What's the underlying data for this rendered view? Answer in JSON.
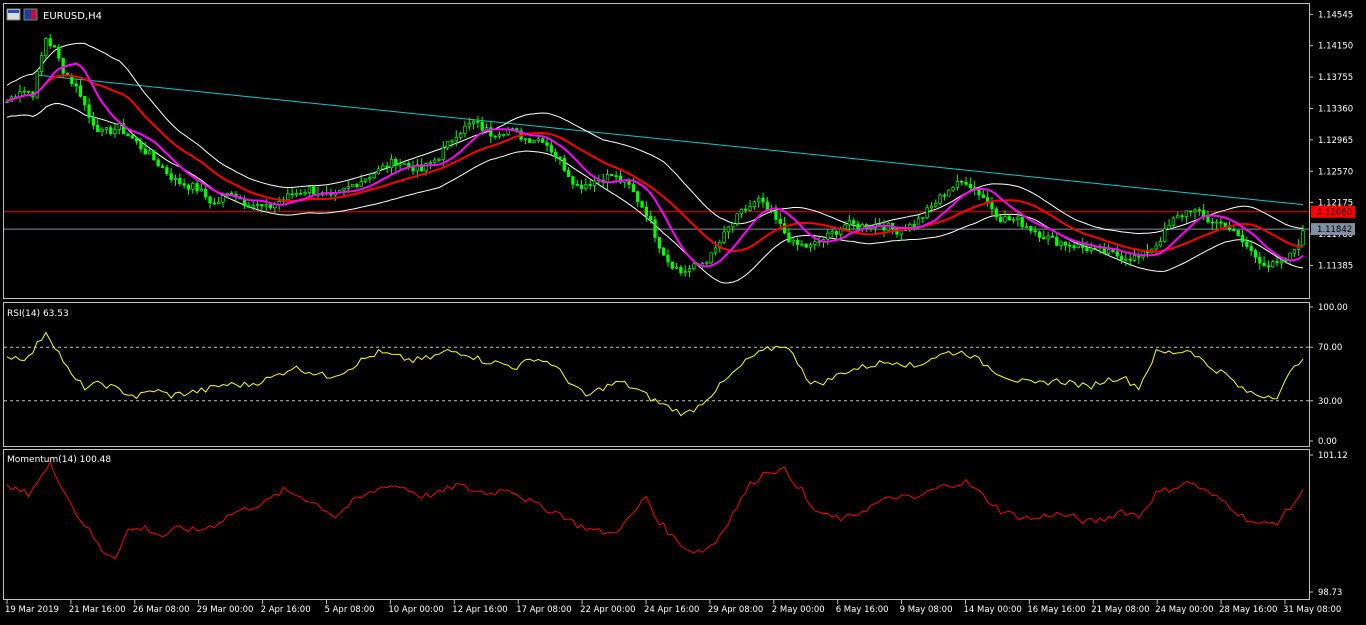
{
  "symbol_label": "EURUSD,H4",
  "colors": {
    "background": "#000000",
    "frame": "#c0c0c0",
    "candle": "#00ff00",
    "bollinger": "#ffffff",
    "ma_fast": "#ff00ff",
    "ma_slow": "#ff0000",
    "trendline": "#00ced1",
    "h_red": "#ff0000",
    "h_grey": "#8090a0",
    "rsi_line": "#ffff00",
    "momentum_line": "#ff0000",
    "axis_text": "#ffffff"
  },
  "chart_data": [
    {
      "type": "candlestick",
      "title": "EURUSD,H4",
      "ylim": [
        1.11,
        1.1465
      ],
      "y_ticks": [
        "1.14545",
        "1.14150",
        "1.13755",
        "1.13360",
        "1.12965",
        "1.12570",
        "1.12175",
        "1.11780",
        "1.11385"
      ],
      "y_tick_values": [
        1.14545,
        1.1415,
        1.13755,
        1.1336,
        1.12965,
        1.1257,
        1.12175,
        1.1178,
        1.11385
      ],
      "price_labels": [
        {
          "value": 1.1206,
          "text": "1.12060",
          "color": "#ff0000"
        },
        {
          "value": 1.11842,
          "text": "1.11842",
          "color": "#8090a0"
        }
      ],
      "trendline": {
        "start": [
          "19 Mar 2019",
          1.1378
        ],
        "end": [
          "31 May 08:00",
          1.1215
        ]
      },
      "close_path": [
        [
          0,
          1.1345
        ],
        [
          3,
          1.136
        ],
        [
          6,
          1.1355
        ],
        [
          9,
          1.1425
        ],
        [
          11,
          1.141
        ],
        [
          13,
          1.1385
        ],
        [
          15,
          1.137
        ],
        [
          17,
          1.1355
        ],
        [
          19,
          1.1325
        ],
        [
          22,
          1.1305
        ],
        [
          26,
          1.1312
        ],
        [
          29,
          1.1298
        ],
        [
          34,
          1.1272
        ],
        [
          39,
          1.1245
        ],
        [
          44,
          1.1235
        ],
        [
          48,
          1.1215
        ],
        [
          52,
          1.1232
        ],
        [
          55,
          1.1218
        ],
        [
          60,
          1.121
        ],
        [
          66,
          1.1228
        ],
        [
          70,
          1.1235
        ],
        [
          75,
          1.1222
        ],
        [
          80,
          1.124
        ],
        [
          85,
          1.1255
        ],
        [
          90,
          1.127
        ],
        [
          96,
          1.1258
        ],
        [
          100,
          1.1276
        ],
        [
          104,
          1.1305
        ],
        [
          108,
          1.1318
        ],
        [
          112,
          1.1305
        ],
        [
          116,
          1.131
        ],
        [
          120,
          1.1298
        ],
        [
          124,
          1.1298
        ],
        [
          128,
          1.127
        ],
        [
          132,
          1.1238
        ],
        [
          136,
          1.1245
        ],
        [
          140,
          1.1252
        ],
        [
          144,
          1.1238
        ],
        [
          148,
          1.1205
        ],
        [
          151,
          1.1165
        ],
        [
          153,
          1.1145
        ],
        [
          156,
          1.113
        ],
        [
          160,
          1.1138
        ],
        [
          163,
          1.115
        ],
        [
          167,
          1.1185
        ],
        [
          170,
          1.1205
        ],
        [
          174,
          1.122
        ],
        [
          178,
          1.1195
        ],
        [
          182,
          1.1165
        ],
        [
          186,
          1.1162
        ],
        [
          190,
          1.1175
        ],
        [
          194,
          1.119
        ],
        [
          198,
          1.1188
        ],
        [
          202,
          1.119
        ],
        [
          206,
          1.1183
        ],
        [
          210,
          1.119
        ],
        [
          214,
          1.1212
        ],
        [
          218,
          1.1235
        ],
        [
          222,
          1.1245
        ],
        [
          226,
          1.1225
        ],
        [
          230,
          1.1198
        ],
        [
          234,
          1.1195
        ],
        [
          238,
          1.1182
        ],
        [
          242,
          1.117
        ],
        [
          246,
          1.1165
        ],
        [
          250,
          1.116
        ],
        [
          254,
          1.1155
        ],
        [
          258,
          1.115
        ],
        [
          262,
          1.1148
        ],
        [
          266,
          1.1165
        ],
        [
          270,
          1.1195
        ],
        [
          274,
          1.121
        ],
        [
          278,
          1.1195
        ],
        [
          282,
          1.119
        ],
        [
          286,
          1.1168
        ],
        [
          289,
          1.115
        ],
        [
          292,
          1.1138
        ],
        [
          295,
          1.114
        ],
        [
          297,
          1.115
        ],
        [
          300,
          1.1178
        ]
      ],
      "bollinger_offsets": [
        [
          0,
          0.002
        ],
        [
          9,
          0.003
        ],
        [
          18,
          0.0045
        ],
        [
          26,
          0.004
        ],
        [
          40,
          0.0022
        ],
        [
          56,
          0.0018
        ],
        [
          70,
          0.0017
        ],
        [
          85,
          0.002
        ],
        [
          100,
          0.0024
        ],
        [
          112,
          0.0018
        ],
        [
          124,
          0.0025
        ],
        [
          138,
          0.003
        ],
        [
          152,
          0.0045
        ],
        [
          166,
          0.004
        ],
        [
          180,
          0.002
        ],
        [
          196,
          0.001
        ],
        [
          210,
          0.0015
        ],
        [
          224,
          0.0022
        ],
        [
          238,
          0.0016
        ],
        [
          252,
          0.0014
        ],
        [
          268,
          0.0026
        ],
        [
          282,
          0.002
        ],
        [
          300,
          0.0025
        ]
      ]
    },
    {
      "type": "line",
      "title": "RSI(14) 63.53",
      "name": "RSI(14)",
      "current": 63.53,
      "ylim": [
        0,
        100
      ],
      "y_ticks": [
        "100.00",
        "70.00",
        "30.00",
        "0.00"
      ],
      "y_tick_values": [
        100,
        70,
        30,
        0
      ],
      "levels": [
        70,
        30
      ],
      "path": [
        [
          0,
          63
        ],
        [
          5,
          62
        ],
        [
          9,
          82
        ],
        [
          12,
          66
        ],
        [
          15,
          48
        ],
        [
          18,
          40
        ],
        [
          22,
          43
        ],
        [
          26,
          38
        ],
        [
          30,
          33
        ],
        [
          34,
          38
        ],
        [
          38,
          34
        ],
        [
          42,
          36
        ],
        [
          46,
          38
        ],
        [
          50,
          42
        ],
        [
          56,
          42
        ],
        [
          62,
          48
        ],
        [
          66,
          55
        ],
        [
          70,
          52
        ],
        [
          74,
          48
        ],
        [
          78,
          52
        ],
        [
          82,
          60
        ],
        [
          86,
          66
        ],
        [
          90,
          63
        ],
        [
          94,
          60
        ],
        [
          98,
          62
        ],
        [
          102,
          67
        ],
        [
          106,
          66
        ],
        [
          110,
          60
        ],
        [
          114,
          58
        ],
        [
          118,
          55
        ],
        [
          122,
          62
        ],
        [
          126,
          58
        ],
        [
          130,
          45
        ],
        [
          134,
          33
        ],
        [
          138,
          40
        ],
        [
          142,
          44
        ],
        [
          146,
          38
        ],
        [
          150,
          30
        ],
        [
          154,
          24
        ],
        [
          157,
          20
        ],
        [
          160,
          26
        ],
        [
          164,
          38
        ],
        [
          168,
          50
        ],
        [
          172,
          62
        ],
        [
          176,
          68
        ],
        [
          180,
          72
        ],
        [
          184,
          55
        ],
        [
          186,
          42
        ],
        [
          190,
          45
        ],
        [
          194,
          52
        ],
        [
          198,
          55
        ],
        [
          202,
          58
        ],
        [
          206,
          60
        ],
        [
          210,
          55
        ],
        [
          214,
          62
        ],
        [
          218,
          66
        ],
        [
          222,
          66
        ],
        [
          226,
          58
        ],
        [
          230,
          50
        ],
        [
          234,
          45
        ],
        [
          238,
          42
        ],
        [
          242,
          45
        ],
        [
          246,
          44
        ],
        [
          250,
          40
        ],
        [
          254,
          45
        ],
        [
          258,
          48
        ],
        [
          262,
          40
        ],
        [
          266,
          66
        ],
        [
          270,
          66
        ],
        [
          274,
          68
        ],
        [
          278,
          56
        ],
        [
          282,
          50
        ],
        [
          286,
          38
        ],
        [
          290,
          34
        ],
        [
          294,
          34
        ],
        [
          297,
          50
        ],
        [
          300,
          63.5
        ]
      ]
    },
    {
      "type": "line",
      "title": "Momentum(14) 100.48",
      "name": "Momentum(14)",
      "current": 100.48,
      "ylim": [
        98.73,
        101.12
      ],
      "y_ticks": [
        "101.12",
        "98.73"
      ],
      "y_tick_values": [
        101.12,
        98.73
      ],
      "path": [
        [
          0,
          100.55
        ],
        [
          5,
          100.45
        ],
        [
          10,
          100.95
        ],
        [
          13,
          100.55
        ],
        [
          16,
          100.1
        ],
        [
          19,
          99.8
        ],
        [
          22,
          99.45
        ],
        [
          25,
          99.35
        ],
        [
          28,
          99.8
        ],
        [
          32,
          99.85
        ],
        [
          36,
          99.7
        ],
        [
          40,
          99.85
        ],
        [
          44,
          99.8
        ],
        [
          48,
          99.9
        ],
        [
          52,
          100.1
        ],
        [
          56,
          100.2
        ],
        [
          60,
          100.3
        ],
        [
          64,
          100.5
        ],
        [
          68,
          100.4
        ],
        [
          72,
          100.25
        ],
        [
          76,
          100.05
        ],
        [
          80,
          100.3
        ],
        [
          84,
          100.45
        ],
        [
          88,
          100.6
        ],
        [
          92,
          100.55
        ],
        [
          96,
          100.4
        ],
        [
          100,
          100.45
        ],
        [
          104,
          100.6
        ],
        [
          108,
          100.5
        ],
        [
          112,
          100.45
        ],
        [
          116,
          100.55
        ],
        [
          120,
          100.35
        ],
        [
          124,
          100.2
        ],
        [
          128,
          100.1
        ],
        [
          132,
          99.9
        ],
        [
          136,
          99.8
        ],
        [
          140,
          99.75
        ],
        [
          144,
          100.0
        ],
        [
          148,
          100.4
        ],
        [
          150,
          100.05
        ],
        [
          154,
          99.7
        ],
        [
          158,
          99.45
        ],
        [
          161,
          99.45
        ],
        [
          164,
          99.6
        ],
        [
          168,
          100.1
        ],
        [
          172,
          100.6
        ],
        [
          176,
          100.85
        ],
        [
          180,
          100.85
        ],
        [
          184,
          100.5
        ],
        [
          186,
          100.2
        ],
        [
          190,
          100.05
        ],
        [
          194,
          100.0
        ],
        [
          198,
          100.15
        ],
        [
          202,
          100.3
        ],
        [
          206,
          100.4
        ],
        [
          210,
          100.35
        ],
        [
          214,
          100.5
        ],
        [
          218,
          100.6
        ],
        [
          222,
          100.65
        ],
        [
          226,
          100.4
        ],
        [
          230,
          100.15
        ],
        [
          234,
          100.05
        ],
        [
          238,
          100.0
        ],
        [
          242,
          100.1
        ],
        [
          246,
          100.05
        ],
        [
          250,
          99.95
        ],
        [
          254,
          100.0
        ],
        [
          258,
          100.15
        ],
        [
          262,
          100.05
        ],
        [
          266,
          100.45
        ],
        [
          270,
          100.55
        ],
        [
          274,
          100.65
        ],
        [
          278,
          100.45
        ],
        [
          282,
          100.3
        ],
        [
          286,
          100.05
        ],
        [
          290,
          99.9
        ],
        [
          294,
          99.95
        ],
        [
          297,
          100.2
        ],
        [
          300,
          100.48
        ]
      ]
    }
  ],
  "time_axis": [
    "19 Mar 2019",
    "21 Mar 16:00",
    "26 Mar 08:00",
    "29 Mar 00:00",
    "2 Apr 16:00",
    "5 Apr 08:00",
    "10 Apr 00:00",
    "12 Apr 16:00",
    "17 Apr 08:00",
    "22 Apr 00:00",
    "24 Apr 16:00",
    "29 Apr 08:00",
    "2 May 00:00",
    "6 May 16:00",
    "9 May 08:00",
    "14 May 00:00",
    "16 May 16:00",
    "21 May 08:00",
    "24 May 00:00",
    "28 May 16:00",
    "31 May 08:00"
  ]
}
